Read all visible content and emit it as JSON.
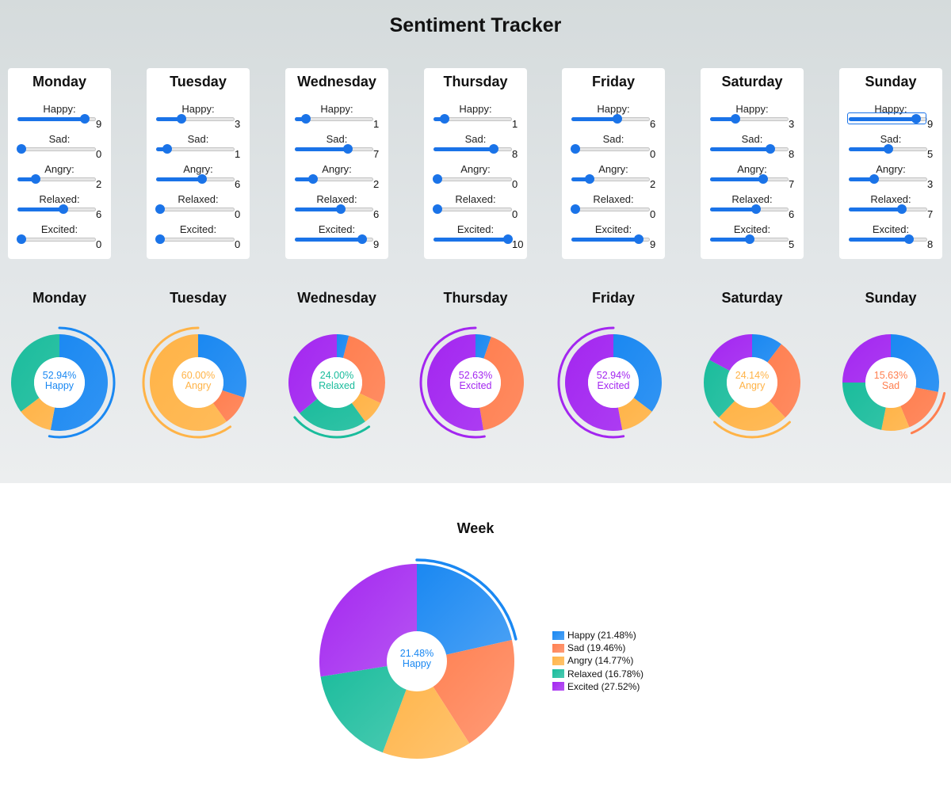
{
  "title": "Sentiment Tracker",
  "emotions": [
    "Happy",
    "Sad",
    "Angry",
    "Relaxed",
    "Excited"
  ],
  "colors": {
    "Happy": "#1a88f2",
    "Sad": "#ff7f50",
    "Angry": "#ffb347",
    "Relaxed": "#1abc9c",
    "Excited": "#a326f0"
  },
  "slider_max": 10,
  "days": [
    {
      "name": "Monday",
      "sliders": [
        {
          "label": "Happy:",
          "value": 9
        },
        {
          "label": "Sad:",
          "value": 0
        },
        {
          "label": "Angry:",
          "value": 2
        },
        {
          "label": "Relaxed:",
          "value": 6
        },
        {
          "label": "Excited:",
          "value": 0
        }
      ],
      "center_pct": "52.94%",
      "center_label": "Happy",
      "highlight": "Happy"
    },
    {
      "name": "Tuesday",
      "sliders": [
        {
          "label": "Happy:",
          "value": 3
        },
        {
          "label": "Sad:",
          "value": 1
        },
        {
          "label": "Angry:",
          "value": 6
        },
        {
          "label": "Relaxed:",
          "value": 0
        },
        {
          "label": "Excited:",
          "value": 0
        }
      ],
      "center_pct": "60.00%",
      "center_label": "Angry",
      "highlight": "Angry"
    },
    {
      "name": "Wednesday",
      "sliders": [
        {
          "label": "Happy:",
          "value": 1
        },
        {
          "label": "Sad:",
          "value": 7
        },
        {
          "label": "Angry:",
          "value": 2
        },
        {
          "label": "Relaxed:",
          "value": 6
        },
        {
          "label": "Excited:",
          "value": 9
        }
      ],
      "center_pct": "24.00%",
      "center_label": "Relaxed",
      "highlight": "Relaxed"
    },
    {
      "name": "Thursday",
      "sliders": [
        {
          "label": "Happy:",
          "value": 1
        },
        {
          "label": "Sad:",
          "value": 8
        },
        {
          "label": "Angry:",
          "value": 0
        },
        {
          "label": "Relaxed:",
          "value": 0
        },
        {
          "label": "Excited:",
          "value": 10
        }
      ],
      "center_pct": "52.63%",
      "center_label": "Excited",
      "highlight": "Excited"
    },
    {
      "name": "Friday",
      "sliders": [
        {
          "label": "Happy:",
          "value": 6
        },
        {
          "label": "Sad:",
          "value": 0
        },
        {
          "label": "Angry:",
          "value": 2
        },
        {
          "label": "Relaxed:",
          "value": 0
        },
        {
          "label": "Excited:",
          "value": 9
        }
      ],
      "center_pct": "52.94%",
      "center_label": "Excited",
      "highlight": "Excited"
    },
    {
      "name": "Saturday",
      "sliders": [
        {
          "label": "Happy:",
          "value": 3
        },
        {
          "label": "Sad:",
          "value": 8
        },
        {
          "label": "Angry:",
          "value": 7
        },
        {
          "label": "Relaxed:",
          "value": 6
        },
        {
          "label": "Excited:",
          "value": 5
        }
      ],
      "center_pct": "24.14%",
      "center_label": "Angry",
      "highlight": "Angry"
    },
    {
      "name": "Sunday",
      "sliders": [
        {
          "label": "Happy:",
          "value": 9
        },
        {
          "label": "Sad:",
          "value": 5
        },
        {
          "label": "Angry:",
          "value": 3
        },
        {
          "label": "Relaxed:",
          "value": 7
        },
        {
          "label": "Excited:",
          "value": 8
        }
      ],
      "center_pct": "15.63%",
      "center_label": "Sad",
      "highlight": "Sad"
    }
  ],
  "focused_slider": {
    "day": "Sunday",
    "label": "Happy:"
  },
  "week": {
    "title": "Week",
    "center_pct": "21.48%",
    "center_label": "Happy",
    "highlight": "Happy",
    "legend": [
      "Happy (21.48%)",
      "Sad (19.46%)",
      "Angry (14.77%)",
      "Relaxed (16.78%)",
      "Excited (27.52%)"
    ]
  },
  "chart_data": [
    {
      "type": "pie",
      "title": "Monday",
      "categories": [
        "Happy",
        "Sad",
        "Angry",
        "Relaxed",
        "Excited"
      ],
      "values": [
        9,
        0,
        2,
        6,
        0
      ]
    },
    {
      "type": "pie",
      "title": "Tuesday",
      "categories": [
        "Happy",
        "Sad",
        "Angry",
        "Relaxed",
        "Excited"
      ],
      "values": [
        3,
        1,
        6,
        0,
        0
      ]
    },
    {
      "type": "pie",
      "title": "Wednesday",
      "categories": [
        "Happy",
        "Sad",
        "Angry",
        "Relaxed",
        "Excited"
      ],
      "values": [
        1,
        7,
        2,
        6,
        9
      ]
    },
    {
      "type": "pie",
      "title": "Thursday",
      "categories": [
        "Happy",
        "Sad",
        "Angry",
        "Relaxed",
        "Excited"
      ],
      "values": [
        1,
        8,
        0,
        0,
        10
      ]
    },
    {
      "type": "pie",
      "title": "Friday",
      "categories": [
        "Happy",
        "Sad",
        "Angry",
        "Relaxed",
        "Excited"
      ],
      "values": [
        6,
        0,
        2,
        0,
        9
      ]
    },
    {
      "type": "pie",
      "title": "Saturday",
      "categories": [
        "Happy",
        "Sad",
        "Angry",
        "Relaxed",
        "Excited"
      ],
      "values": [
        3,
        8,
        7,
        6,
        5
      ]
    },
    {
      "type": "pie",
      "title": "Sunday",
      "categories": [
        "Happy",
        "Sad",
        "Angry",
        "Relaxed",
        "Excited"
      ],
      "values": [
        9,
        5,
        3,
        7,
        8
      ]
    },
    {
      "type": "pie",
      "title": "Week",
      "categories": [
        "Happy",
        "Sad",
        "Angry",
        "Relaxed",
        "Excited"
      ],
      "values": [
        32,
        29,
        22,
        25,
        41
      ]
    }
  ]
}
